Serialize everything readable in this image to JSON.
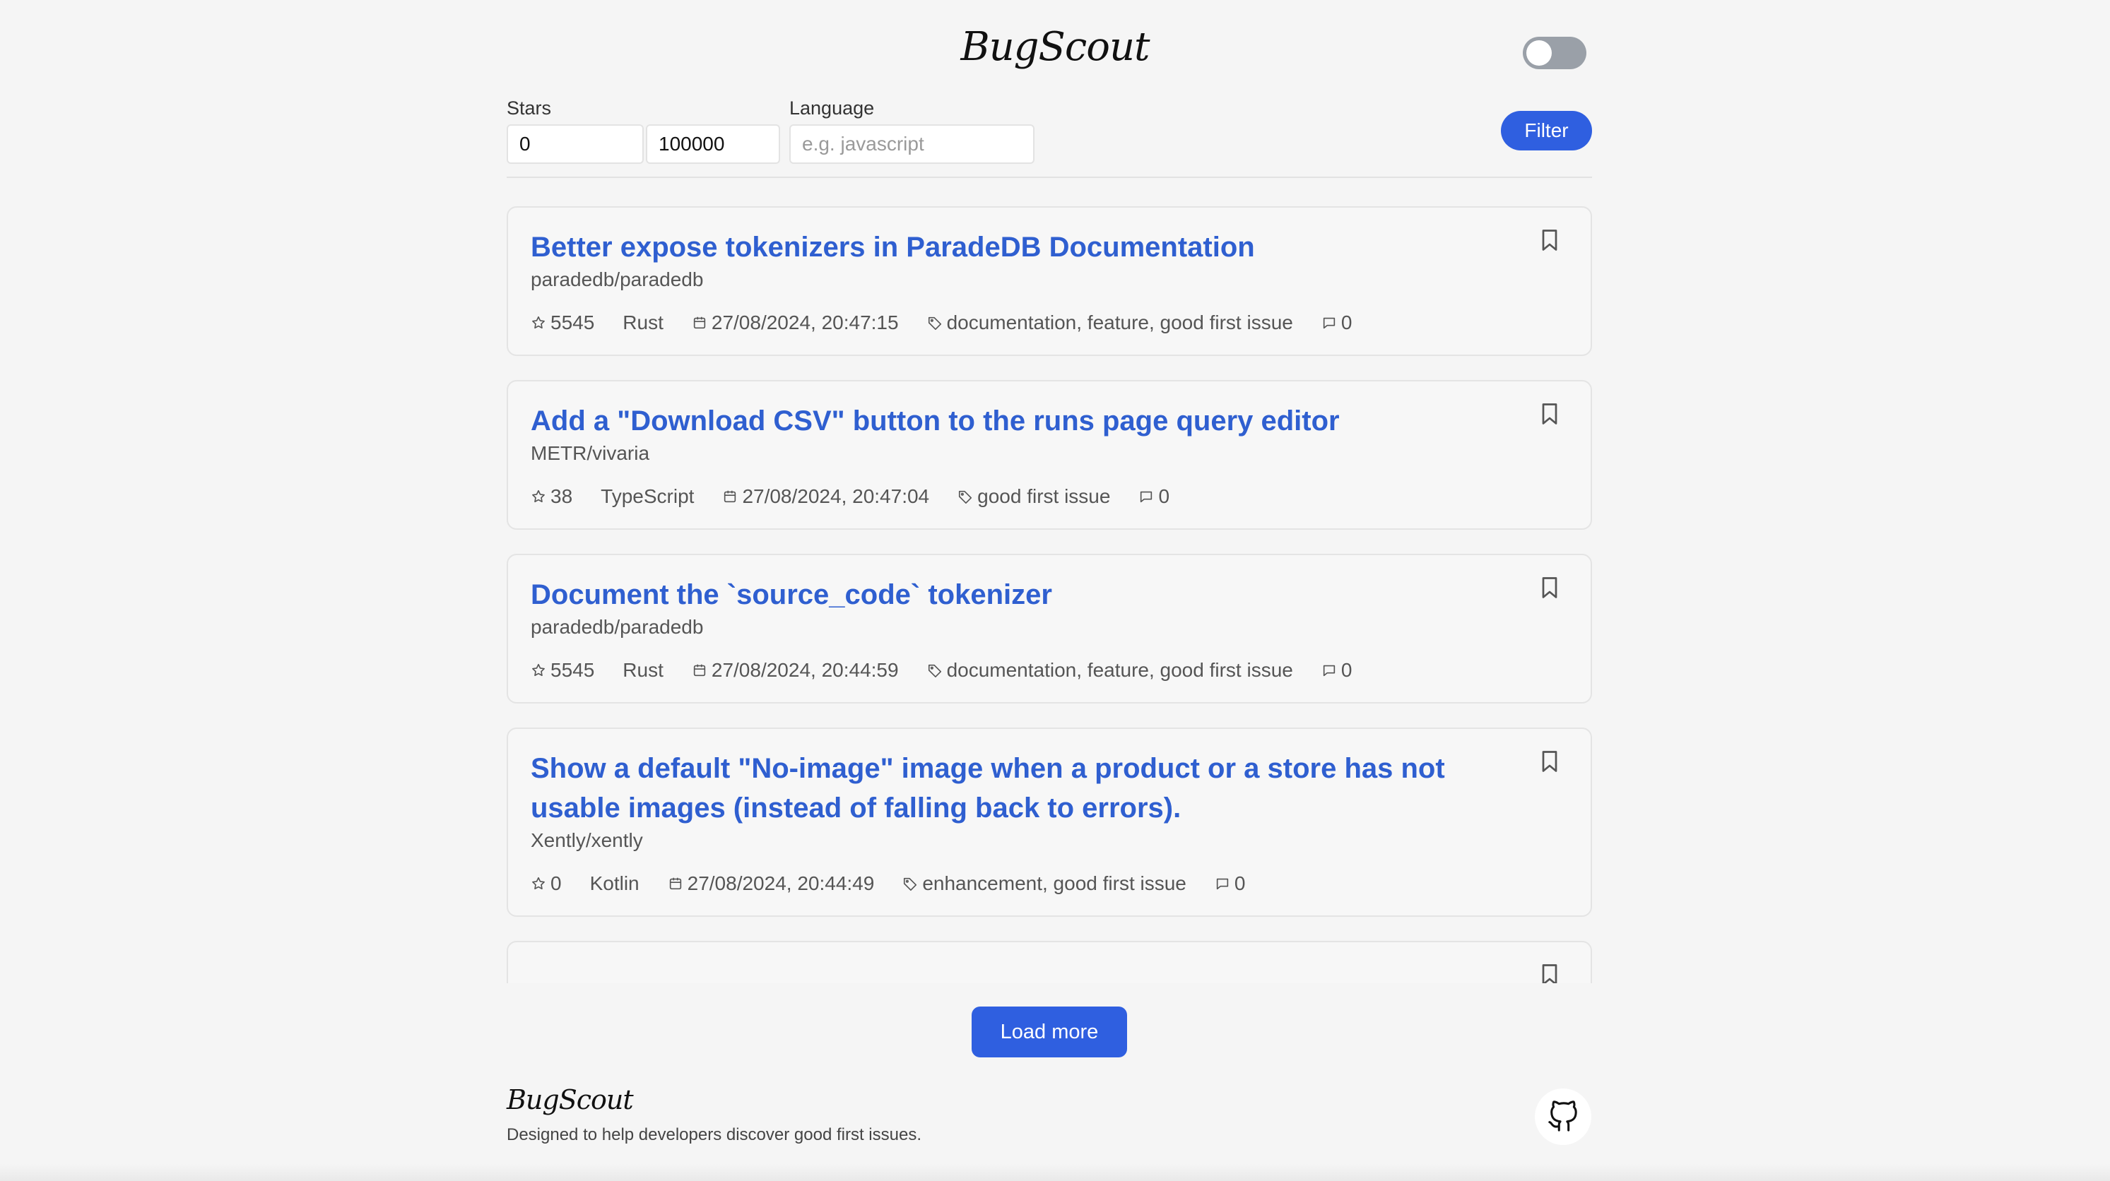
{
  "header": {
    "logo_text": "BugScout",
    "theme_toggle_state": "off"
  },
  "filters": {
    "stars_label": "Stars",
    "stars_min_value": "0",
    "stars_max_value": "100000",
    "language_label": "Language",
    "language_placeholder": "e.g. javascript",
    "language_value": "",
    "filter_button_label": "Filter"
  },
  "issues": [
    {
      "title": "Better expose tokenizers in ParadeDB Documentation",
      "repo": "paradedb/paradedb",
      "stars": "5545",
      "language": "Rust",
      "date": "27/08/2024, 20:47:15",
      "labels": "documentation, feature, good first issue",
      "comments": "0"
    },
    {
      "title": "Add a \"Download CSV\" button to the runs page query editor",
      "repo": "METR/vivaria",
      "stars": "38",
      "language": "TypeScript",
      "date": "27/08/2024, 20:47:04",
      "labels": "good first issue",
      "comments": "0"
    },
    {
      "title": "Document the `source_code` tokenizer",
      "repo": "paradedb/paradedb",
      "stars": "5545",
      "language": "Rust",
      "date": "27/08/2024, 20:44:59",
      "labels": "documentation, feature, good first issue",
      "comments": "0"
    },
    {
      "title": "Show a default \"No-image\" image when a product or a store has not usable images (instead of falling back to errors).",
      "repo": "Xently/xently",
      "stars": "0",
      "language": "Kotlin",
      "date": "27/08/2024, 20:44:49",
      "labels": "enhancement, good first issue",
      "comments": "0"
    }
  ],
  "load_more_label": "Load more",
  "footer": {
    "logo_text": "BugScout",
    "tagline": "Designed to help developers discover good first issues."
  },
  "icons": {
    "star": "star-icon",
    "calendar": "calendar-icon",
    "tag": "tag-icon",
    "comment": "comment-icon",
    "bookmark": "bookmark-icon",
    "github": "github-icon"
  },
  "colors": {
    "accent": "#2f5fe0",
    "title_link": "#2f5fd0",
    "background": "#f5f5f5"
  }
}
